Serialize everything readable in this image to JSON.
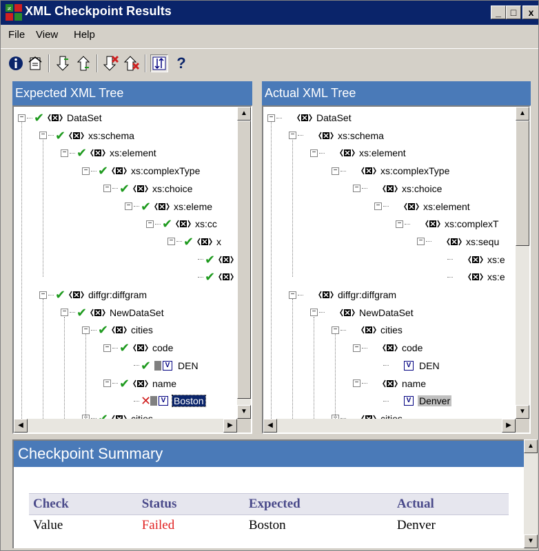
{
  "window": {
    "title": "XML Checkpoint Results",
    "controls": [
      "_",
      "□",
      "x"
    ]
  },
  "menu": {
    "file": "File",
    "view": "View",
    "help": "Help"
  },
  "toolbar": {
    "help_glyph": "?"
  },
  "expected_pane": {
    "title": "Expected XML Tree",
    "nodes": {
      "n0": "DataSet",
      "n1": "xs:schema",
      "n2": "xs:element",
      "n3": "xs:complexType",
      "n4": "xs:choice",
      "n5": "xs:eleme",
      "n6": "xs:cc",
      "n7": "x",
      "n10": "diffgr:diffgram",
      "n11": "NewDataSet",
      "n12": "cities",
      "n13": "code",
      "n14": "DEN",
      "n15": "name",
      "n16": "Boston",
      "n17": "cities"
    }
  },
  "actual_pane": {
    "title": "Actual XML Tree",
    "nodes": {
      "n0": "DataSet",
      "n1": "xs:schema",
      "n2": "xs:element",
      "n3": "xs:complexType",
      "n4": "xs:choice",
      "n5": "xs:element",
      "n6": "xs:complexT",
      "n7": "xs:sequ",
      "n8": "xs:e",
      "n9": "xs:e",
      "n10": "diffgr:diffgram",
      "n11": "NewDataSet",
      "n12": "cities",
      "n13": "code",
      "n14": "DEN",
      "n15": "name",
      "n16": "Denver",
      "n17": "cities"
    }
  },
  "summary": {
    "title": "Checkpoint Summary",
    "columns": [
      "Check",
      "Status",
      "Expected",
      "Actual"
    ],
    "rows": [
      {
        "check": "Value",
        "status": "Failed",
        "expected": "Boston",
        "actual": "Denver"
      }
    ]
  },
  "colors": {
    "title_bar": "#0a246a",
    "pane_header": "#4a7ab8",
    "check_green": "#1e9a1e",
    "failed_red": "#e02020",
    "selection": "#0a246a"
  }
}
